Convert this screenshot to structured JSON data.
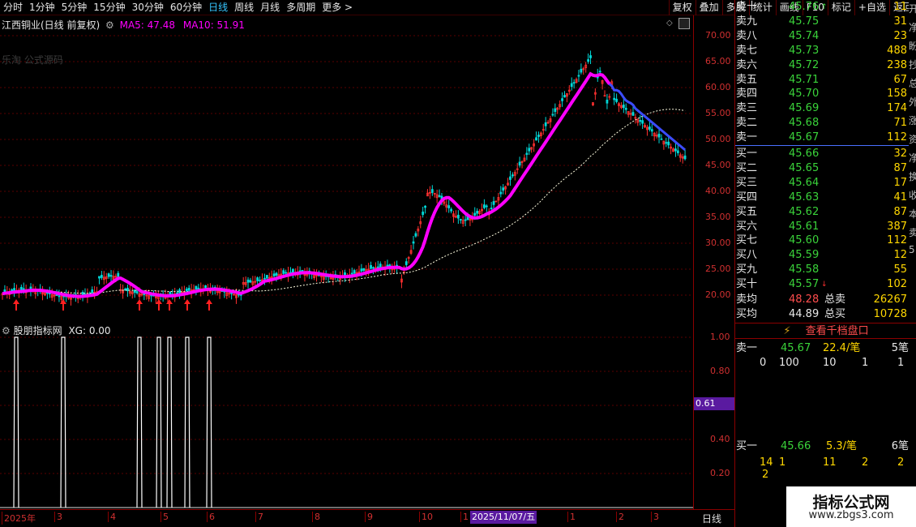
{
  "toolbar": {
    "left": [
      "分时",
      "1分钟",
      "5分钟",
      "15分钟",
      "30分钟",
      "60分钟",
      "日线",
      "周线",
      "月线",
      "多周期",
      "更多 >"
    ],
    "active_index": 6,
    "right": [
      "复权",
      "叠加",
      "多股",
      "统计",
      "画线",
      "F10",
      "标记",
      "+自选",
      "返回"
    ]
  },
  "main": {
    "stock_name": "江西铜业(日线 前复权)",
    "ma5_label": "MA5: 47.48",
    "ma10_label": "MA10: 51.91",
    "source_watermark": "乐淘 公式源码",
    "price_ticks": [
      "70.00",
      "65.00",
      "60.00",
      "55.00",
      "50.00",
      "45.00",
      "40.00",
      "35.00",
      "30.00",
      "25.00",
      "20.00"
    ]
  },
  "indicator": {
    "name": "股朋指标网",
    "xg_label": "XG: 0.00",
    "ticks": [
      "1.00",
      "0.80",
      "0.60",
      "0.40",
      "0.20"
    ],
    "cursor_value": "0.61"
  },
  "time_axis": {
    "labels": [
      "2025年",
      "3",
      "4",
      "5",
      "6",
      "7",
      "8",
      "9",
      "10",
      "1",
      "1",
      "2",
      "3"
    ],
    "cursor_date": "2025/11/07/五",
    "period": "日线"
  },
  "orderbook": {
    "sells": [
      {
        "label": "卖十",
        "price": "45.76",
        "vol": "11",
        "mark": "↑"
      },
      {
        "label": "卖九",
        "price": "45.75",
        "vol": "31"
      },
      {
        "label": "卖八",
        "price": "45.74",
        "vol": "23"
      },
      {
        "label": "卖七",
        "price": "45.73",
        "vol": "488"
      },
      {
        "label": "卖六",
        "price": "45.72",
        "vol": "238"
      },
      {
        "label": "卖五",
        "price": "45.71",
        "vol": "67"
      },
      {
        "label": "卖四",
        "price": "45.70",
        "vol": "158"
      },
      {
        "label": "卖三",
        "price": "45.69",
        "vol": "174"
      },
      {
        "label": "卖二",
        "price": "45.68",
        "vol": "71"
      },
      {
        "label": "卖一",
        "price": "45.67",
        "vol": "112"
      }
    ],
    "buys": [
      {
        "label": "买一",
        "price": "45.66",
        "vol": "32"
      },
      {
        "label": "买二",
        "price": "45.65",
        "vol": "87"
      },
      {
        "label": "买三",
        "price": "45.64",
        "vol": "17"
      },
      {
        "label": "买四",
        "price": "45.63",
        "vol": "41"
      },
      {
        "label": "买五",
        "price": "45.62",
        "vol": "87"
      },
      {
        "label": "买六",
        "price": "45.61",
        "vol": "387"
      },
      {
        "label": "买七",
        "price": "45.60",
        "vol": "112"
      },
      {
        "label": "买八",
        "price": "45.59",
        "vol": "12"
      },
      {
        "label": "买九",
        "price": "45.58",
        "vol": "55"
      },
      {
        "label": "买十",
        "price": "45.57",
        "vol": "102",
        "mark": "↓"
      }
    ],
    "avg_sell_label": "卖均",
    "avg_sell_price": "48.28",
    "total_sell_label": "总卖",
    "total_sell": "26267",
    "avg_buy_label": "买均",
    "avg_buy_price": "44.89",
    "total_buy_label": "总买",
    "total_buy": "10728",
    "thousand_btn": "查看千档盘口",
    "sell1": {
      "label": "卖一",
      "price": "45.67",
      "qty": "22.4/笔",
      "count": "5笔",
      "detail": [
        "0",
        "100",
        "10",
        "1",
        "1"
      ]
    },
    "buy1": {
      "label": "买一",
      "price": "45.66",
      "qty": "5.3/笔",
      "count": "6笔",
      "detail": [
        "14",
        "1",
        "11",
        "2",
        "2"
      ],
      "detail2": "2"
    },
    "side_strip": [
      "开",
      "净",
      "盼",
      "抄",
      "总",
      "外",
      "涨",
      "资",
      "净",
      "换",
      "收",
      "本",
      "卖",
      "5"
    ]
  },
  "brand": {
    "name": "指标公式网",
    "url": "www.zbgs3.com"
  },
  "colors": {
    "up": "#ff3030",
    "down": "#00d8d8",
    "ma5": "#ff00ff",
    "ma10": "#ffffff",
    "ma_blue": "#3b4cff",
    "grid": "#5a0000",
    "bg": "#000000"
  }
}
